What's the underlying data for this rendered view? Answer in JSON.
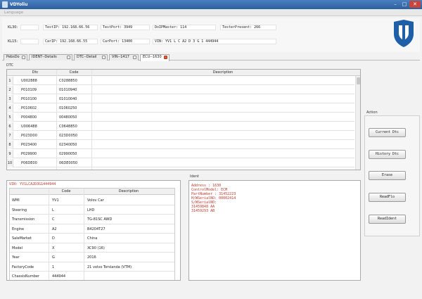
{
  "window": {
    "title": "VDYoliu"
  },
  "menu": {
    "language": "Language"
  },
  "info": {
    "kl30_label": "KL30:",
    "kl15_label": "KL15:",
    "testip_label": "TestIP: 192.168.66.56",
    "testport_label": "TestPort: 3949",
    "doip_label": "DoIPMaster: 114",
    "tester_label": "TesterPresent: 266",
    "carip_label": "CarIP: 192.168.66.55",
    "carport_label": "CarPort: 13400",
    "vin_label": "VIN: YV1 L C A2 D 3 G 1 444944"
  },
  "tabs": [
    {
      "label": "PebsDo"
    },
    {
      "label": "IDENT--Details"
    },
    {
      "label": "DTC--Detail"
    },
    {
      "label": "VIN--1417"
    },
    {
      "label": "ECU--1630"
    }
  ],
  "dtc": {
    "section_label": "DTC",
    "columns": {
      "dtc": "Dtc",
      "code": "Code",
      "description": "Description"
    },
    "rows": [
      {
        "num": "1",
        "dtc": "U002888",
        "code": "C0288850"
      },
      {
        "num": "2",
        "dtc": "P010109",
        "code": "01010940"
      },
      {
        "num": "3",
        "dtc": "P010100",
        "code": "01010040"
      },
      {
        "num": "4",
        "dtc": "P010602",
        "code": "01060250"
      },
      {
        "num": "5",
        "dtc": "P004800",
        "code": "00480050"
      },
      {
        "num": "6",
        "dtc": "U006488",
        "code": "C0648850"
      },
      {
        "num": "7",
        "dtc": "P023D00",
        "code": "023D0050"
      },
      {
        "num": "8",
        "dtc": "P023400",
        "code": "02340050"
      },
      {
        "num": "9",
        "dtc": "P029900",
        "code": "02990050"
      },
      {
        "num": "10",
        "dtc": "P06DE00",
        "code": "06DE0050"
      }
    ]
  },
  "vin_panel": {
    "vin_line": "VIN: YV1LCA2D3G1444944",
    "columns": {
      "code": "Code",
      "description": "Description"
    },
    "rows": [
      {
        "field": "WMI",
        "code": "YV1",
        "description": "Volov Car"
      },
      {
        "field": "Steering",
        "code": "L",
        "description": "LHD"
      },
      {
        "field": "Transmission",
        "code": "C",
        "description": "TG-81SC AWD"
      },
      {
        "field": "Engine",
        "code": "A2",
        "description": "B4204T27"
      },
      {
        "field": "SaleMarket",
        "code": "D",
        "description": "China"
      },
      {
        "field": "Model",
        "code": "X",
        "description": "XC90 (16)"
      },
      {
        "field": "Year",
        "code": "G",
        "description": "2016"
      },
      {
        "field": "FactoryCode",
        "code": "1",
        "description": "21 volvo Torslanda (VTM)"
      },
      {
        "field": "ChassisNumber",
        "code": "444944",
        "description": ""
      }
    ]
  },
  "ident": {
    "section_label": "Ident",
    "lines": [
      "Address    : 1630",
      "ControlModel: ECM",
      "PartNumber  : 31452223",
      "H/WSerialNO: 00002414",
      "S/WSerialNO:",
      "              31459848 AA",
      "              31459293 AB"
    ]
  },
  "actions": {
    "section_label": "Action",
    "buttons": [
      "Current Dtc",
      "History Dtc",
      "Erase",
      "ReadFlo",
      "ReadIdent"
    ]
  },
  "colors": {
    "accent": "#2d5f9e",
    "error_text": "#c0392b",
    "logo_blue": "#1f5fa8"
  }
}
